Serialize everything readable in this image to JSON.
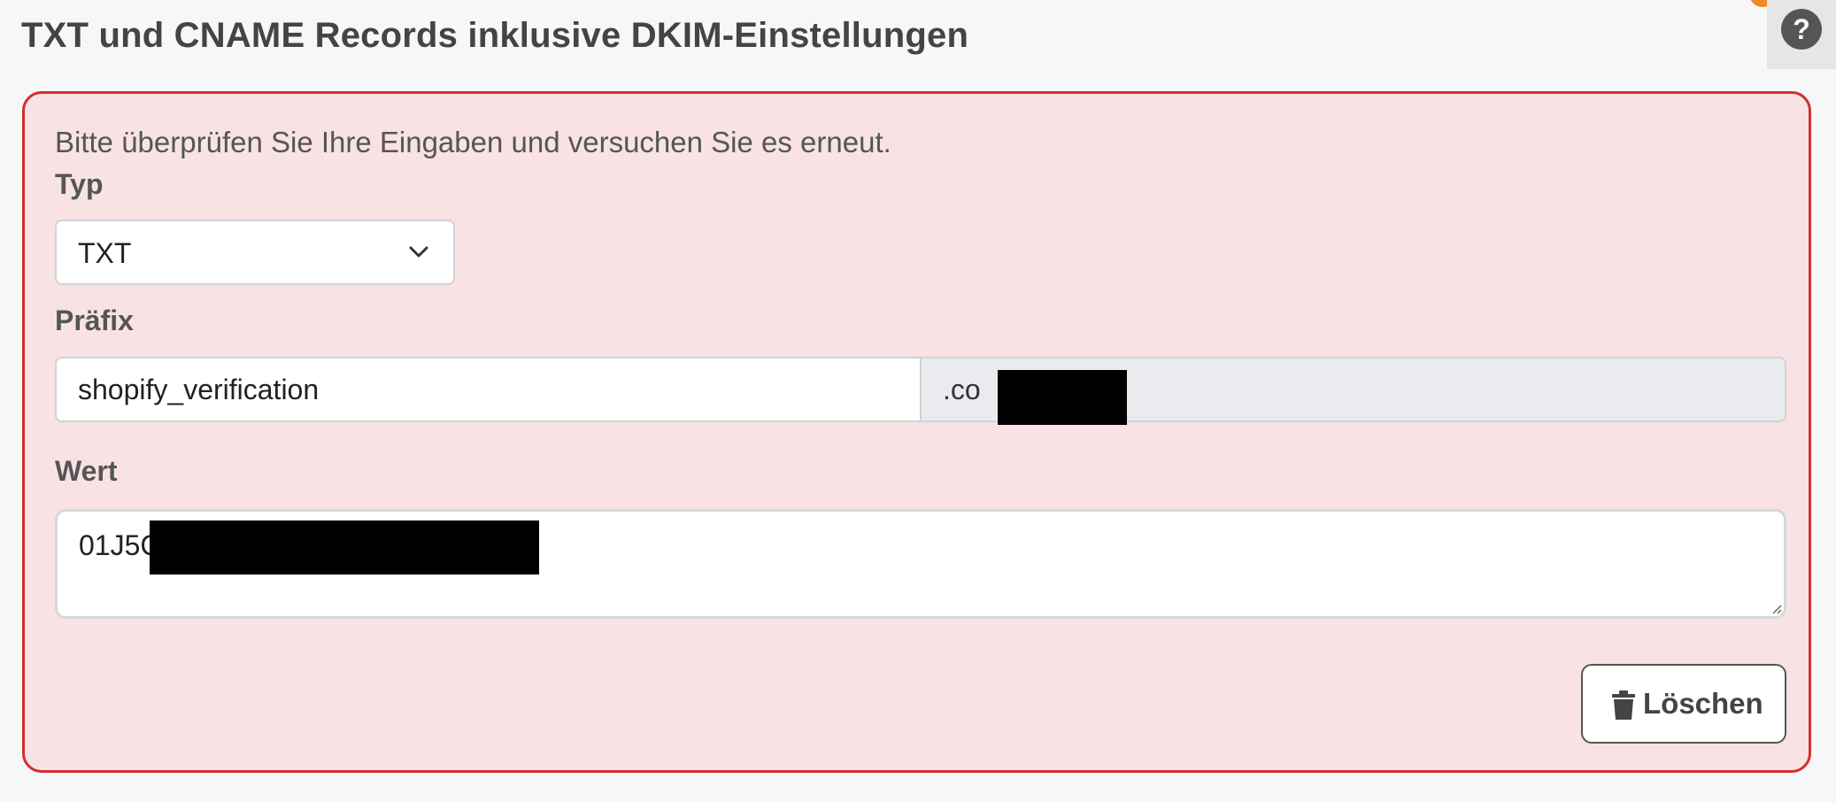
{
  "header": {
    "title": "TXT und CNAME Records inklusive DKIM-Einstellungen",
    "help_label": "?"
  },
  "colors": {
    "error_background": "#f8e2e3",
    "error_border": "#d22f2f",
    "notification": "#f08a2c"
  },
  "form": {
    "error_message": "Bitte überprüfen Sie Ihre Eingaben und versuchen Sie es erneut.",
    "type": {
      "label": "Typ",
      "selected": "TXT"
    },
    "prefix": {
      "label": "Präfix",
      "value": "shopify_verification",
      "domain_suffix": ".co        n.de"
    },
    "value": {
      "label": "Wert",
      "text": "01J5C"
    },
    "delete_button": {
      "label": "Löschen",
      "icon": "trash-icon"
    }
  }
}
